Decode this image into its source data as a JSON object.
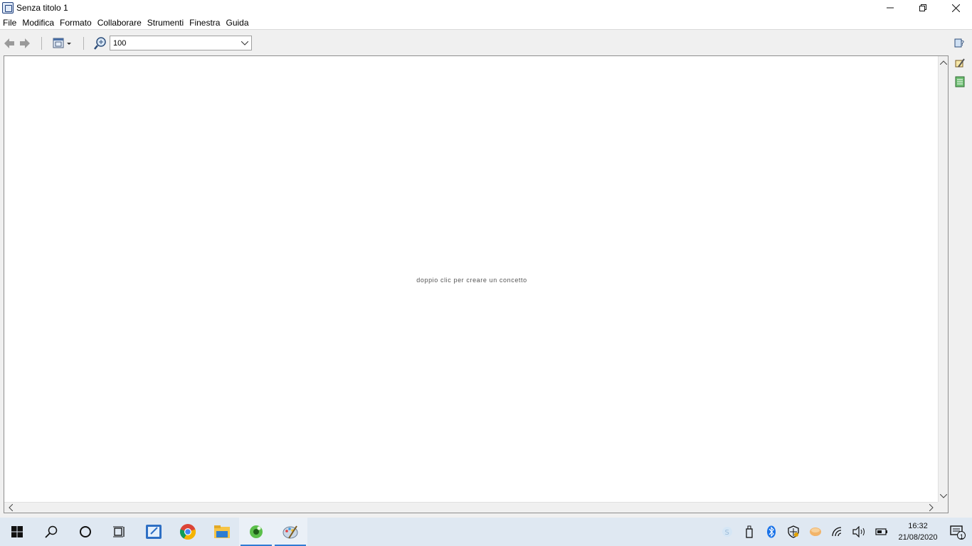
{
  "window": {
    "title": "Senza titolo 1",
    "minimize_glyph": "—",
    "restore_glyph": "❐",
    "close_glyph": "✕"
  },
  "menu": {
    "items": [
      "File",
      "Modifica",
      "Formato",
      "Collaborare",
      "Strumenti",
      "Finestra",
      "Guida"
    ]
  },
  "toolbar": {
    "zoom_value": "100",
    "icons": [
      "back-arrow-icon",
      "forward-arrow-icon",
      "view-options-icon",
      "zoom-icon",
      "dropdown-chevron-icon"
    ]
  },
  "side_palette": {
    "icons": [
      "help-icon",
      "styles-icon",
      "outline-icon"
    ]
  },
  "canvas": {
    "hint": "doppio clic per creare un concetto"
  },
  "taskbar": {
    "apps": [
      "start-icon",
      "search-icon",
      "cortana-icon",
      "task-view-icon",
      "notes-icon",
      "chrome-icon",
      "file-explorer-icon",
      "cmaptools-icon",
      "paint-icon"
    ],
    "active_apps": [
      "cmaptools-icon",
      "paint-icon"
    ]
  },
  "tray": {
    "time": "16:32",
    "date": "21/08/2020",
    "notification_count": "1"
  },
  "colors": {
    "accent": "#2f7bd4",
    "taskbar_bg": "#dfe8f2"
  }
}
